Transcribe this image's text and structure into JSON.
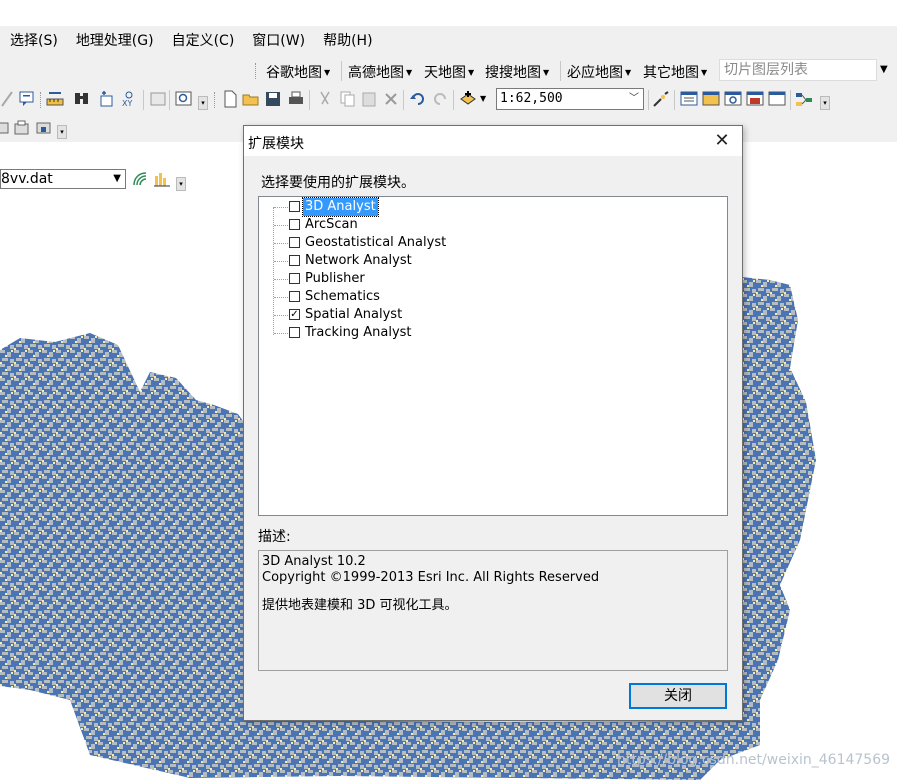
{
  "menu": [
    "选择(S)",
    "地理处理(G)",
    "自定义(C)",
    "窗口(W)",
    "帮助(H)"
  ],
  "map_services": {
    "items": [
      "谷歌地图",
      "高德地图",
      "天地图",
      "搜搜地图",
      "必应地图",
      "其它地图"
    ],
    "tile_layer_list_placeholder": "切片图层列表"
  },
  "standard_toolbar": {
    "scale_value": "1:62,500",
    "icons": [
      "clear-selection-icon",
      "identify-icon",
      "measure-icon",
      "find-icon",
      "add-xy-icon",
      "go-to-xy-icon",
      "magnify-icon",
      "new-icon",
      "open-icon",
      "save-icon",
      "print-icon",
      "cut-icon",
      "copy-icon",
      "paste-icon",
      "delete-icon",
      "undo-icon",
      "redo-icon",
      "add-data-icon",
      "editor-toolbar-icon",
      "table-of-contents-icon",
      "catalog-icon",
      "search-window-icon",
      "arctoolbox-icon",
      "python-window-icon",
      "model-builder-icon"
    ]
  },
  "layer_toolbar": {
    "layer_value": "8vv.dat"
  },
  "dialog": {
    "title": "扩展模块",
    "close_glyph": "✕",
    "choose_label": "选择要使用的扩展模块。",
    "extensions": [
      {
        "label": "3D Analyst",
        "checked": false,
        "selected": true
      },
      {
        "label": "ArcScan",
        "checked": false,
        "selected": false
      },
      {
        "label": "Geostatistical Analyst",
        "checked": false,
        "selected": false
      },
      {
        "label": "Network Analyst",
        "checked": false,
        "selected": false
      },
      {
        "label": "Publisher",
        "checked": false,
        "selected": false
      },
      {
        "label": "Schematics",
        "checked": false,
        "selected": false
      },
      {
        "label": "Spatial Analyst",
        "checked": true,
        "selected": false
      },
      {
        "label": "Tracking Analyst",
        "checked": false,
        "selected": false
      }
    ],
    "description_label": "描述:",
    "description": {
      "line1": "3D Analyst 10.2",
      "line2": "Copyright ©1999-2013 Esri Inc. All Rights Reserved",
      "line3": "提供地表建模和 3D 可视化工具。"
    },
    "close_button": "关闭"
  },
  "watermark": "https://blog.csdn.net/weixin_46147569",
  "colors": {
    "map_blue": "#4a74b4",
    "map_gray": "#b4bcc4",
    "map_yellow": "#f4eeb0",
    "selection": "#3399ff",
    "button_border": "#0078d7"
  }
}
